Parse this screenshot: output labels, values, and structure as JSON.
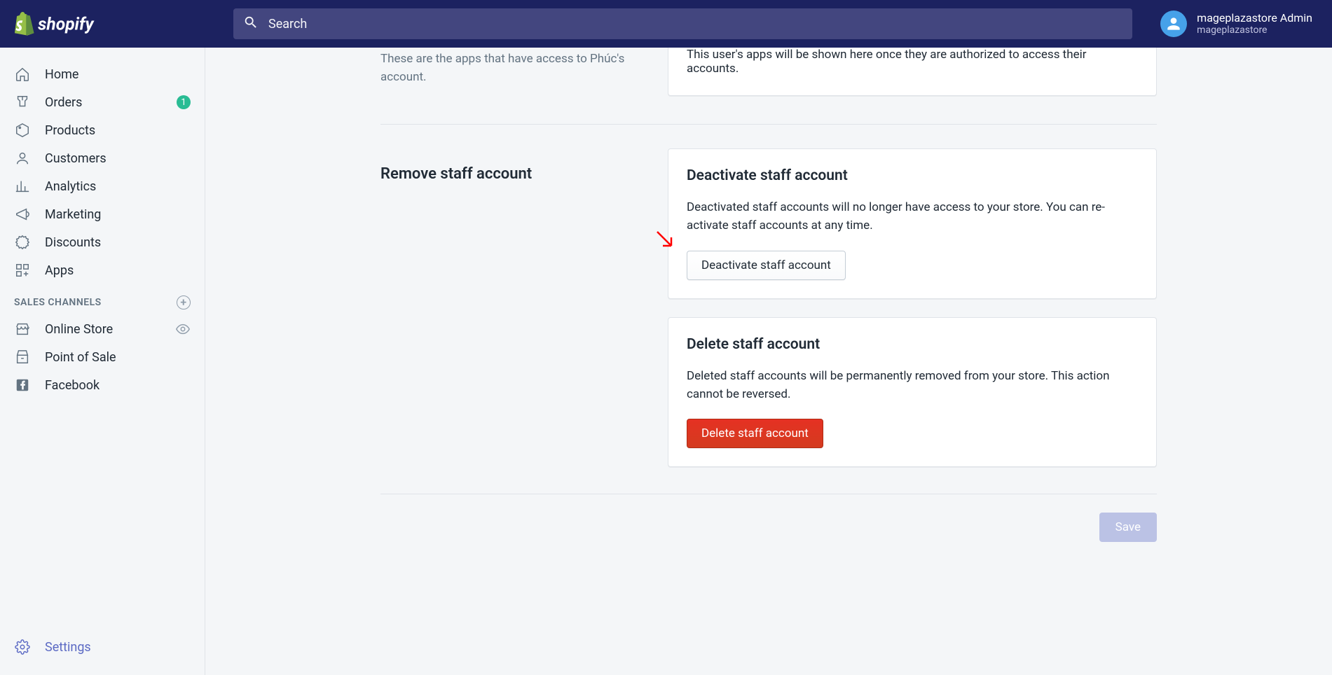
{
  "header": {
    "search_placeholder": "Search",
    "user_name": "mageplazastore Admin",
    "store_name": "mageplazastore"
  },
  "sidebar": {
    "items": [
      {
        "label": "Home"
      },
      {
        "label": "Orders",
        "badge": "1"
      },
      {
        "label": "Products"
      },
      {
        "label": "Customers"
      },
      {
        "label": "Analytics"
      },
      {
        "label": "Marketing"
      },
      {
        "label": "Discounts"
      },
      {
        "label": "Apps"
      }
    ],
    "channels_header": "SALES CHANNELS",
    "channels": [
      {
        "label": "Online Store"
      },
      {
        "label": "Point of Sale"
      },
      {
        "label": "Facebook"
      }
    ],
    "settings_label": "Settings"
  },
  "apps_section": {
    "desc": "These are the apps that have access to Phúc's account.",
    "card_text": "This user's apps will be shown here once they are authorized to access their accounts."
  },
  "remove_section": {
    "title": "Remove staff account",
    "deactivate": {
      "title": "Deactivate staff account",
      "desc": "Deactivated staff accounts will no longer have access to your store. You can re-activate staff accounts at any time.",
      "button": "Deactivate staff account"
    },
    "delete": {
      "title": "Delete staff account",
      "desc": "Deleted staff accounts will be permanently removed from your store. This action cannot be reversed.",
      "button": "Delete staff account"
    }
  },
  "footer": {
    "save_label": "Save"
  }
}
